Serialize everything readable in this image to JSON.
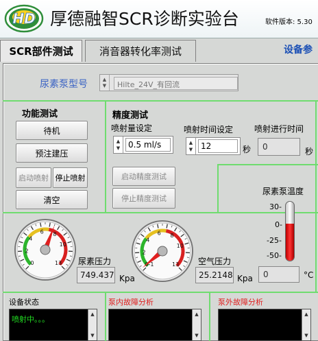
{
  "header": {
    "logo_text": "HD",
    "title": "厚德融智SCR诊断实验台",
    "version_label": "软件版本: 5.30"
  },
  "tabs": [
    {
      "label": "SCR部件测试"
    },
    {
      "label": "消音器转化率测试"
    },
    {
      "label": "设备参"
    }
  ],
  "pump": {
    "label": "尿素泵型号",
    "value": "Hilte_24V_有回流"
  },
  "function_test": {
    "title": "功能测试",
    "standby": "待机",
    "prefill": "预注建压",
    "start_spray": "启动喷射",
    "stop_spray": "停止喷射",
    "clear": "清空"
  },
  "precision_test": {
    "title": "精度测试",
    "spray_amount_label": "喷射量设定",
    "spray_amount_value": "0.5 ml/s",
    "spray_time_label": "喷射时间设定",
    "spray_time_value": "12",
    "spray_time_unit": "秒",
    "elapsed_label": "喷射进行时间",
    "elapsed_value": "0",
    "elapsed_unit": "秒",
    "start_btn": "启动精度测试",
    "stop_btn": "停止精度测试"
  },
  "temperature": {
    "label": "尿素泵温度",
    "ticks": [
      "30-",
      "0-",
      "-25-",
      "-50-"
    ],
    "value": "0",
    "unit": "°C",
    "level_fraction": 0.63
  },
  "urea_gauge": {
    "label": "尿素压力",
    "value": "749.437",
    "unit": "Kpa",
    "ticks": [
      "0",
      "2",
      "4",
      "6",
      "8",
      "10",
      "13"
    ],
    "needle_value": 7.5
  },
  "air_gauge": {
    "label": "空气压力",
    "value": "25.2148",
    "unit": "Kpa",
    "ticks": [
      "0-1",
      "2",
      "4",
      "6",
      "8",
      "10",
      "13"
    ],
    "needle_value": 0.25
  },
  "status": {
    "device_label": "设备状态",
    "device_text": "喷射中。。。",
    "pump_fault_label": "泵内故障分析",
    "ext_fault_label": "泵外故障分析"
  },
  "colors": {
    "accent_blue": "#3b63c4",
    "tab_blue": "#1a4fb5",
    "status_red": "#e02020",
    "group_green": "#6fdc6f",
    "console_green": "#22dd22"
  }
}
